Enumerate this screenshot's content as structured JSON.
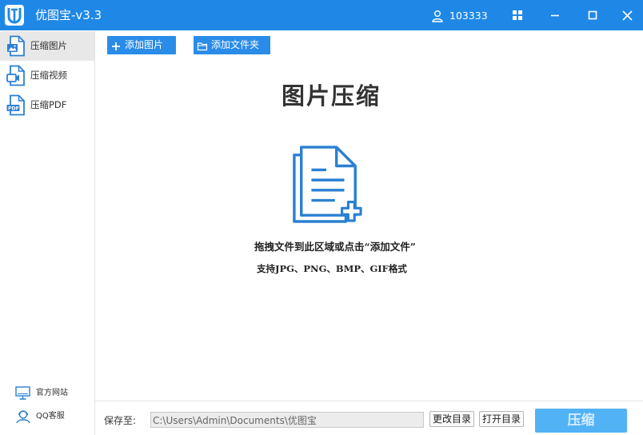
{
  "window": {
    "title": "优图宝-v3.3",
    "user_id": "103333",
    "logo_icon": "app-logo-icon",
    "colors": {
      "primary": "#1f88e6",
      "button": "#2a8ce9",
      "compress_button": "#52b2f6",
      "icon_blue": "#2a7fd4"
    }
  },
  "sidebar": {
    "items": [
      {
        "label": "压缩图片",
        "icon": "image-file-icon",
        "selected": true
      },
      {
        "label": "压缩视频",
        "icon": "video-file-icon",
        "selected": false
      },
      {
        "label": "压缩PDF",
        "icon": "pdf-file-icon",
        "icon_text": "PDF",
        "selected": false
      }
    ],
    "footer": [
      {
        "label": "官方网站",
        "icon": "monitor-icon"
      },
      {
        "label": "QQ客服",
        "icon": "support-person-icon"
      }
    ]
  },
  "toolbar": {
    "add_image_label": "添加图片",
    "add_folder_label": "添加文件夹"
  },
  "dropzone": {
    "title": "图片压缩",
    "icon": "document-add-icon",
    "hint": "拖拽文件到此区域或点击“添加文件”",
    "formats": "支持JPG、PNG、BMP、GIF格式"
  },
  "footer": {
    "save_label": "保存至:",
    "save_path": "C:\\Users\\Admin\\Documents\\优图宝",
    "change_dir_label": "更改目录",
    "open_dir_label": "打开目录",
    "compress_label": "压缩"
  }
}
